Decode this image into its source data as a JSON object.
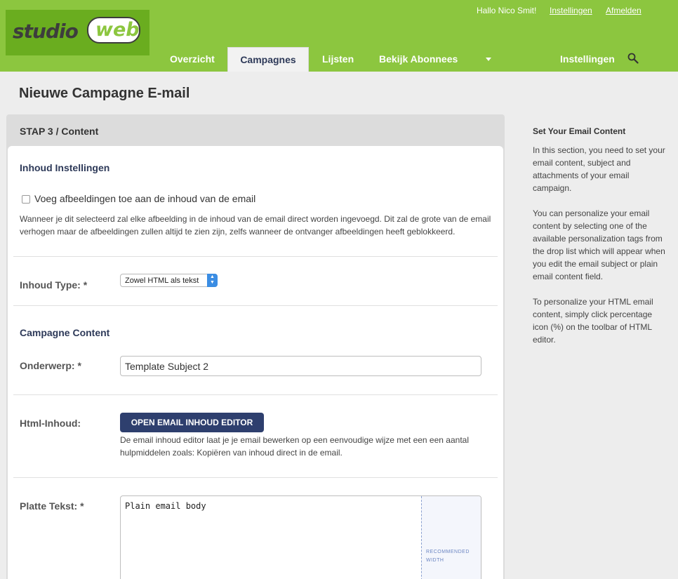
{
  "brand": {
    "part1": "studio",
    "part2": "web"
  },
  "topbar": {
    "greeting": "Hallo Nico Smit!",
    "settings_link": "Instellingen",
    "logout_link": "Afmelden"
  },
  "nav": {
    "overview": "Overzicht",
    "campaigns": "Campagnes",
    "lists": "Lijsten",
    "subscribers": "Bekijk Abonnees",
    "settings": "Instellingen",
    "search_icon": "search-icon"
  },
  "page": {
    "title": "Nieuwe Campagne E-mail"
  },
  "panel": {
    "step": "STAP 3 / Content",
    "content_settings": {
      "title": "Inhoud Instellingen",
      "embed_images_label": "Voeg afbeeldingen toe aan de inhoud van de email",
      "embed_images_checked": false,
      "help_line1": "Wanneer je dit selecteerd zal elke afbeelding in de inhoud van de email direct worden ingevoegd. Dit zal de grote van de email",
      "help_line2": "verhogen maar de afbeeldingen zullen altijd te zien zijn, zelfs wanneer de ontvanger afbeeldingen heeft geblokkeerd."
    },
    "content_type": {
      "label": "Inhoud Type: *",
      "selected": "Zowel HTML als tekst"
    },
    "campaign_content": {
      "title": "Campagne Content"
    },
    "subject": {
      "label": "Onderwerp: *",
      "value": "Template Subject 2"
    },
    "html_content": {
      "label": "Html-Inhoud:",
      "button": "OPEN EMAIL INHOUD EDITOR",
      "help_line1": "De email inhoud editor laat je je email bewerken op een eenvoudige wijze met een een aantal",
      "help_line2": "hulpmiddelen zoals: Kopiëren van inhoud direct in de email."
    },
    "plain_text": {
      "label": "Platte Tekst: *",
      "value": "Plain email body",
      "recommended_line1": "RECOMMENDED",
      "recommended_line2": "WIDTH"
    }
  },
  "sidebar": {
    "title": "Set Your Email Content",
    "p1": "In this section, you need to set your email content, subject and attachments of your email campaign.",
    "p2": "You can personalize your email content by selecting one of the available personalization tags from the drop list which will appear when you edit the email subject or plain email content field.",
    "p3": "To personalize your HTML email content, simply click percentage icon (%) on the toolbar of HTML editor."
  },
  "colors": {
    "header_green": "#8cc63f",
    "logo_green": "#6aad1f",
    "navy": "#2e3f6e",
    "accent_blue": "#3b8de3"
  }
}
